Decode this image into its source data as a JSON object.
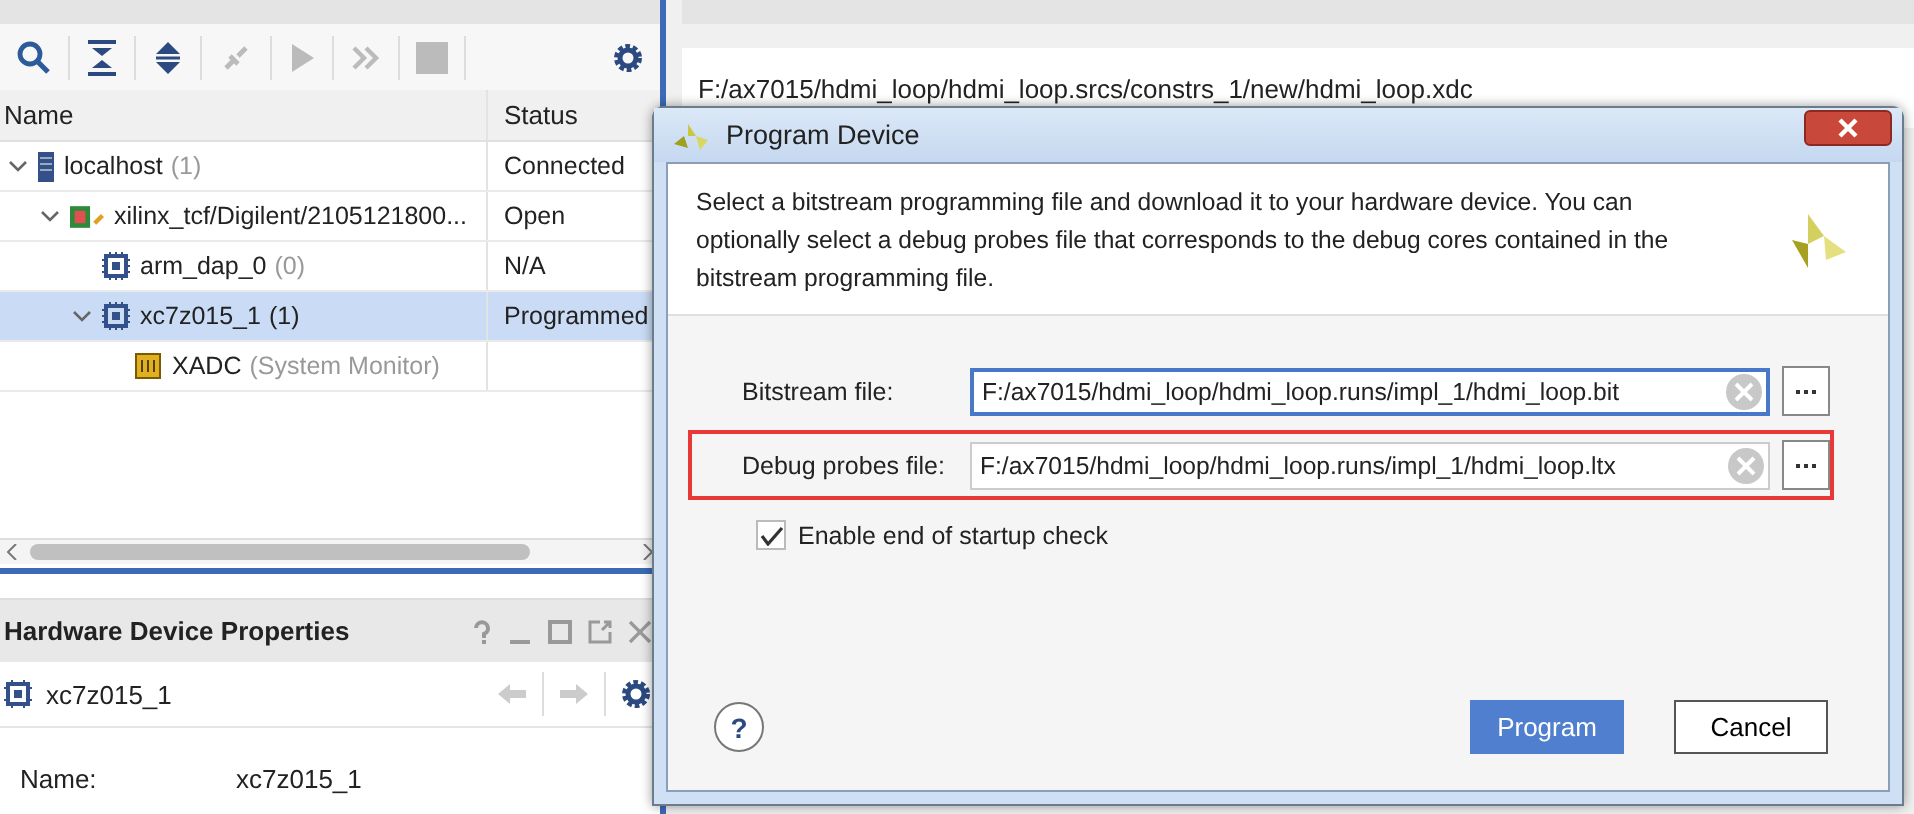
{
  "hardware_panel": {
    "tree": {
      "columns": [
        "Name",
        "Status"
      ],
      "rows": [
        {
          "kind": "host",
          "name": "localhost",
          "detail": "(1)",
          "status": "Connected",
          "expanded": true,
          "selected": false,
          "children": [
            {
              "kind": "cable",
              "name": "xilinx_tcf/Digilent/2105121800...",
              "status": "Open",
              "expanded": true,
              "selected": false,
              "children": [
                {
                  "kind": "chip",
                  "name": "arm_dap_0",
                  "detail": "(0)",
                  "status": "N/A",
                  "selected": false
                },
                {
                  "kind": "chip",
                  "name": "xc7z015_1",
                  "detail": "(1)",
                  "status": "Programmed",
                  "expanded": true,
                  "selected": true,
                  "children": [
                    {
                      "kind": "monitor",
                      "name": "XADC",
                      "detail": "(System Monitor)",
                      "selected": false
                    }
                  ]
                }
              ]
            }
          ]
        }
      ]
    }
  },
  "properties_panel": {
    "title": "Hardware Device Properties",
    "object": "xc7z015_1",
    "properties": [
      {
        "label": "Name:",
        "value": "xc7z015_1"
      }
    ]
  },
  "editor": {
    "path": "F:/ax7015/hdmi_loop/hdmi_loop.srcs/constrs_1/new/hdmi_loop.xdc"
  },
  "dialog": {
    "title": "Program Device",
    "description": "Select a bitstream programming file and download it to your hardware device. You can optionally select a debug probes file that corresponds to the debug cores contained in the bitstream programming file.",
    "fields": [
      {
        "label": "Bitstream file:",
        "value": "F:/ax7015/hdmi_loop/hdmi_loop.runs/impl_1/hdmi_loop.bit",
        "focused": true,
        "highlighted": false
      },
      {
        "label": "Debug probes file:",
        "value": "F:/ax7015/hdmi_loop/hdmi_loop.runs/impl_1/hdmi_loop.ltx",
        "focused": false,
        "highlighted": true
      }
    ],
    "checkbox": {
      "label": "Enable end of startup check",
      "checked": true
    },
    "help_button": "?",
    "buttons": [
      {
        "label": "Program",
        "kind": "primary"
      },
      {
        "label": "Cancel",
        "kind": "secondary"
      }
    ]
  }
}
